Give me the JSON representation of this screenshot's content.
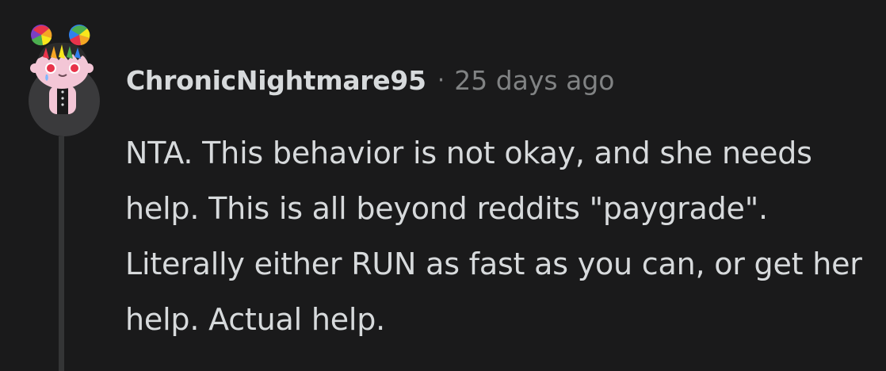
{
  "comment": {
    "author": "ChronicNightmare95",
    "separator": "·",
    "timestamp": "25 days ago",
    "body": "NTA. This behavior is not okay, and she needs help. This is all beyond reddits \"paygrade\". Literally either RUN as fast as you can, or get her help. Actual help.",
    "avatar_icon": "snoo-avatar-rainbow-hair-bunny",
    "colors": {
      "background": "#1a1a1b",
      "text": "#d7dadc",
      "meta": "#818384",
      "thread_line": "#343536"
    }
  }
}
